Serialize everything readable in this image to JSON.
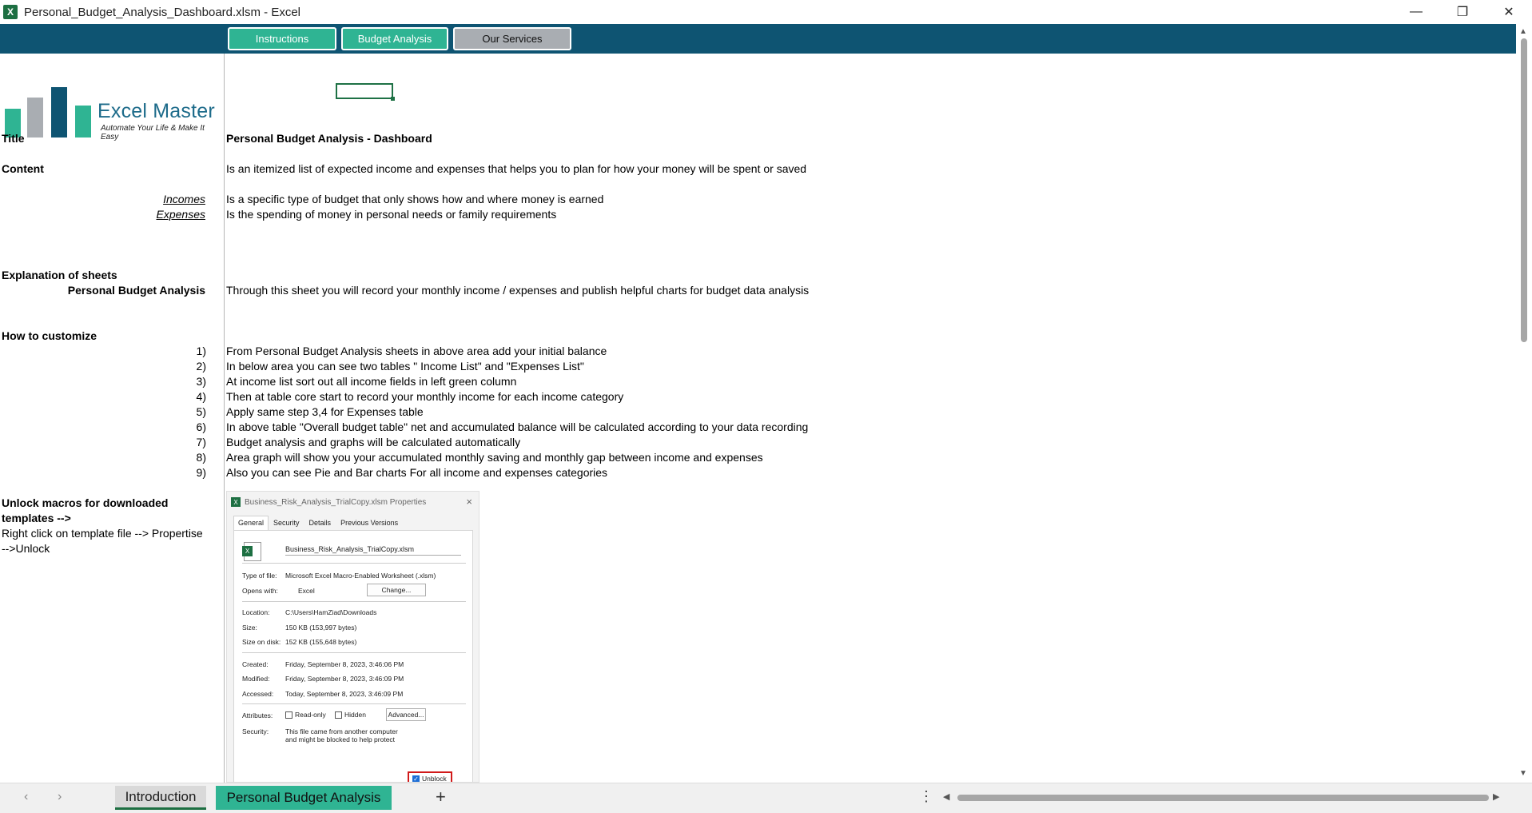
{
  "window": {
    "title": "Personal_Budget_Analysis_Dashboard.xlsm - Excel",
    "app_icon": "X",
    "minimize": "—",
    "restore": "❐",
    "close": "✕"
  },
  "nav": {
    "instructions": "Instructions",
    "budget_analysis": "Budget Analysis",
    "our_services": "Our Services"
  },
  "logo": {
    "title": "Excel Master",
    "subtitle": "Automate Your Life & Make It Easy",
    "colors": [
      "#2fb493",
      "#a9adb2",
      "#0e5472",
      "#2fb493"
    ]
  },
  "content": {
    "title_label": "Title",
    "title_value": "Personal Budget Analysis - Dashboard",
    "content_label": "Content",
    "content_value": "Is an itemized list of expected income and expenses that helps you to plan for how your money will be spent or saved",
    "incomes_label": "Incomes",
    "incomes_value": "Is a specific type of budget that only shows how and where money is earned",
    "expenses_label": "Expenses",
    "expenses_value": "Is the spending of money in personal needs or family requirements",
    "explanation_label": "Explanation of sheets",
    "pba_label": "Personal Budget Analysis",
    "pba_value": "Through this sheet you will record your monthly income / expenses and publish helpful charts for budget data analysis",
    "customize_label": "How to customize",
    "steps": [
      {
        "n": "1)",
        "text": "From Personal Budget Analysis sheets in above area add your initial balance"
      },
      {
        "n": "2)",
        "text": "In below area you can see two tables \" Income List\" and \"Expenses List\""
      },
      {
        "n": "3)",
        "text": "At income list sort out all income fields in left green column"
      },
      {
        "n": "4)",
        "text": "Then at table core start to record your monthly income for each income category"
      },
      {
        "n": "5)",
        "text": "Apply same step 3,4 for Expenses table"
      },
      {
        "n": "6)",
        "text": "In above table \"Overall budget table\" net and accumulated balance will be calculated according to your data recording"
      },
      {
        "n": "7)",
        "text": "Budget analysis and graphs will be calculated automatically"
      },
      {
        "n": "8)",
        "text": "Area graph will show you your accumulated monthly saving and monthly gap between income and expenses"
      },
      {
        "n": "9)",
        "text": "Also you can see Pie and Bar charts For all income and expenses categories"
      }
    ],
    "unlock_label_1": "Unlock macros for downloaded",
    "unlock_label_2": "templates -->",
    "unlock_line_1": "Right click on template file --> Propertise",
    "unlock_line_2": "-->Unlock"
  },
  "dialog": {
    "title": "Business_Risk_Analysis_TrialCopy.xlsm Properties",
    "tabs": [
      "General",
      "Security",
      "Details",
      "Previous Versions"
    ],
    "filename": "Business_Risk_Analysis_TrialCopy.xlsm",
    "type_label": "Type of file:",
    "type_value": "Microsoft Excel Macro-Enabled Worksheet (.xlsm)",
    "opens_label": "Opens with:",
    "opens_value": "Excel",
    "change_btn": "Change...",
    "location_label": "Location:",
    "location_value": "C:\\Users\\HamZiad\\Downloads",
    "size_label": "Size:",
    "size_value": "150 KB (153,997 bytes)",
    "disk_label": "Size on disk:",
    "disk_value": "152 KB (155,648 bytes)",
    "created_label": "Created:",
    "created_value": "Friday, September 8, 2023, 3:46:06 PM",
    "modified_label": "Modified:",
    "modified_value": "Friday, September 8, 2023, 3:46:09 PM",
    "accessed_label": "Accessed:",
    "accessed_value": "Today, September 8, 2023, 3:46:09 PM",
    "attributes_label": "Attributes:",
    "readonly": "Read-only",
    "hidden": "Hidden",
    "advanced_btn": "Advanced...",
    "security_label": "Security:",
    "security_value_1": "This file came from another computer",
    "security_value_2": "and might be blocked to help protect",
    "unlock": "Unblock"
  },
  "tabs": {
    "introduction": "Introduction",
    "personal_budget_analysis": "Personal Budget Analysis",
    "add": "+"
  },
  "accent_colors": {
    "teal_band": "#0e5472",
    "green": "#2fb493",
    "excel_green": "#1d6f42"
  }
}
